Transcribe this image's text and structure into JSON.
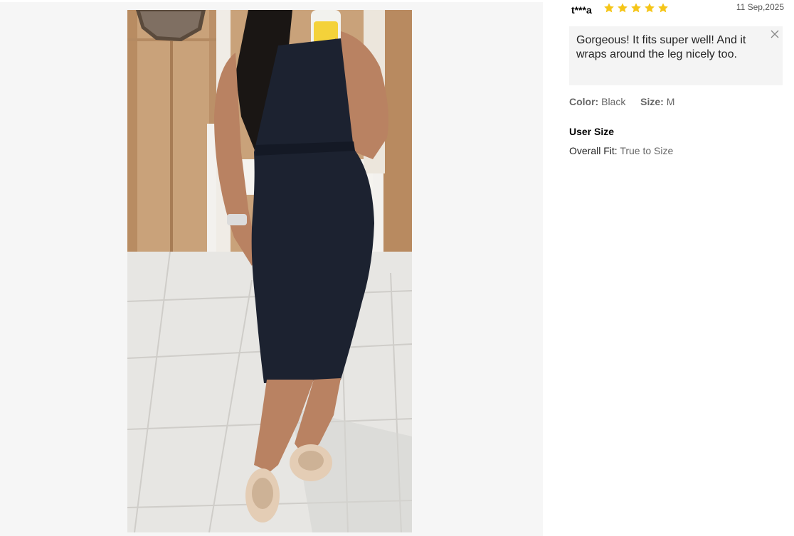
{
  "review": {
    "username": "t***a",
    "rating": 5,
    "star_color": "#f5c518",
    "date": "11 Sep,2025",
    "text": "Gorgeous! It fits super well! And it wraps around the leg nicely too.",
    "close_icon": "close-icon",
    "color_label": "Color:",
    "color_value": "Black",
    "size_label": "Size:",
    "size_value": "M",
    "user_size_title": "User Size",
    "overall_fit_label": "Overall Fit:",
    "overall_fit_value": "True to Size"
  },
  "photo": {
    "panel_bg": "#f6f6f6"
  }
}
